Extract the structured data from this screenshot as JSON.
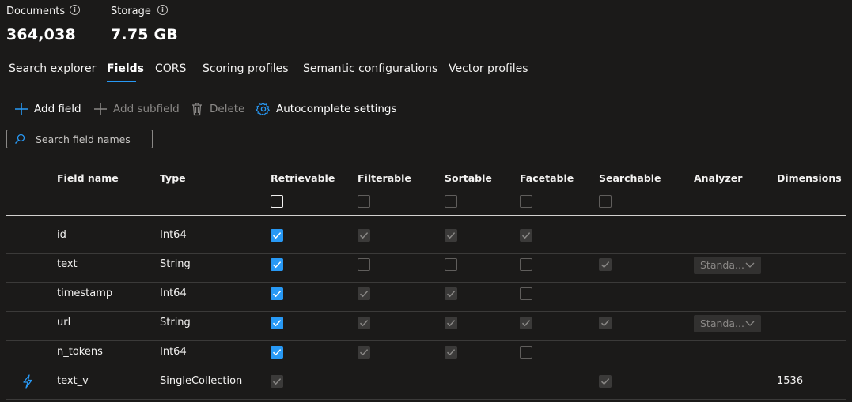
{
  "stats": {
    "documents_label": "Documents",
    "documents_value": "364,038",
    "storage_label": "Storage",
    "storage_value": "7.75 GB",
    "info_glyph": "i"
  },
  "tabs": [
    {
      "label": "Search explorer",
      "active": false
    },
    {
      "label": "Fields",
      "active": true
    },
    {
      "label": "CORS",
      "active": false
    },
    {
      "label": "Scoring profiles",
      "active": false
    },
    {
      "label": "Semantic configurations",
      "active": false
    },
    {
      "label": "Vector profiles",
      "active": false
    }
  ],
  "toolbar": {
    "add_field": "Add field",
    "add_subfield": "Add subfield",
    "delete": "Delete",
    "autocomplete_settings": "Autocomplete settings"
  },
  "search": {
    "placeholder": "Search field names",
    "value": ""
  },
  "table": {
    "columns": [
      "Field name",
      "Type",
      "Retrievable",
      "Filterable",
      "Sortable",
      "Facetable",
      "Searchable",
      "Analyzer",
      "Dimensions"
    ],
    "header_checkboxes": {
      "retrievable": "off-enabled",
      "filterable": "off-disabled",
      "sortable": "off-disabled",
      "facetable": "off-disabled",
      "searchable": "off-disabled"
    },
    "rows": [
      {
        "name": "id",
        "type": "Int64",
        "retrievable": "on",
        "filterable": "dis-checked",
        "sortable": "dis-checked",
        "facetable": "dis-checked",
        "searchable": null,
        "analyzer": "",
        "dimensions": "",
        "vector_icon": false
      },
      {
        "name": "text",
        "type": "String",
        "retrievable": "on",
        "filterable": "off-disabled",
        "sortable": "off-disabled",
        "facetable": "off-disabled",
        "searchable": "dis-checked",
        "analyzer": "Standa...",
        "dimensions": "",
        "vector_icon": false
      },
      {
        "name": "timestamp",
        "type": "Int64",
        "retrievable": "on",
        "filterable": "dis-checked",
        "sortable": "dis-checked",
        "facetable": "off-disabled",
        "searchable": null,
        "analyzer": "",
        "dimensions": "",
        "vector_icon": false
      },
      {
        "name": "url",
        "type": "String",
        "retrievable": "on",
        "filterable": "dis-checked",
        "sortable": "dis-checked",
        "facetable": "dis-checked",
        "searchable": "dis-checked",
        "analyzer": "Standa...",
        "dimensions": "",
        "vector_icon": false
      },
      {
        "name": "n_tokens",
        "type": "Int64",
        "retrievable": "on",
        "filterable": "dis-checked",
        "sortable": "dis-checked",
        "facetable": "off-disabled",
        "searchable": null,
        "analyzer": "",
        "dimensions": "",
        "vector_icon": false
      },
      {
        "name": "text_v",
        "type": "SingleCollection",
        "retrievable": "dis-checked",
        "filterable": null,
        "sortable": null,
        "facetable": null,
        "searchable": "dis-checked",
        "analyzer": "",
        "dimensions": "1536",
        "vector_icon": true
      }
    ]
  },
  "colors": {
    "accent": "#2899f5",
    "background": "#1b1a19",
    "disabled_text": "#8a8886",
    "row_divider": "#3b3a39"
  },
  "icons": {
    "add": "plus-icon",
    "delete": "trash-icon",
    "autocomplete": "gear-icon",
    "search": "search-icon",
    "vector": "lightning-icon",
    "analyzer_dropdown": "chevron-down-icon"
  }
}
